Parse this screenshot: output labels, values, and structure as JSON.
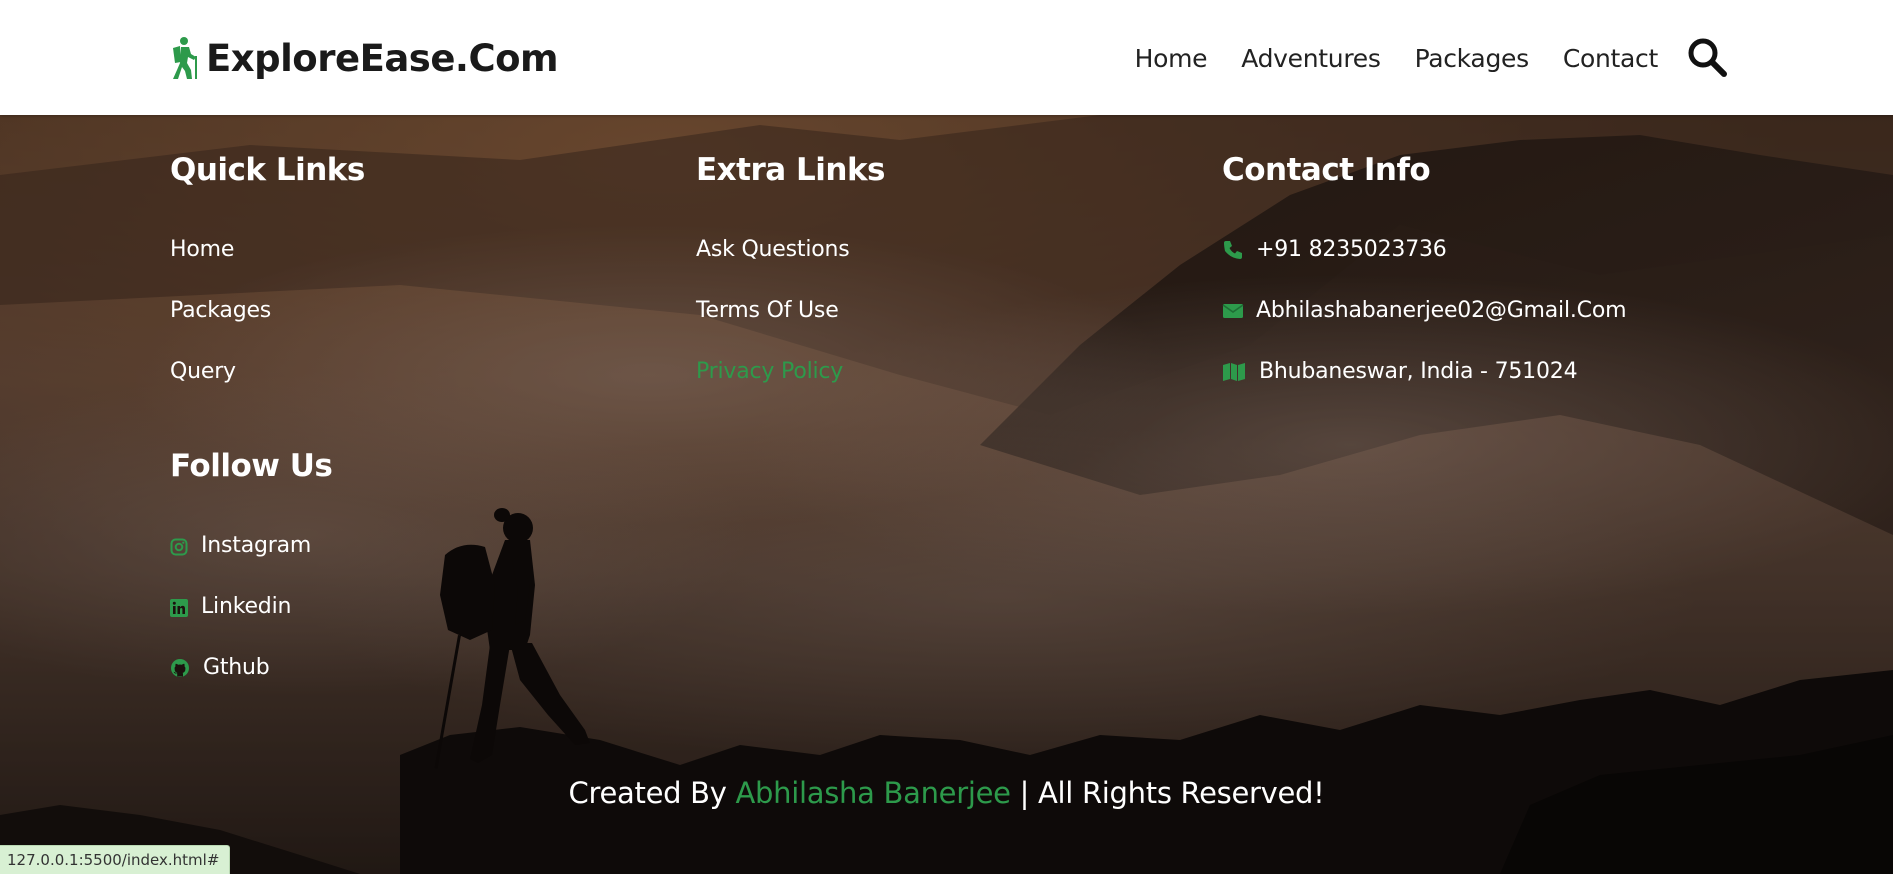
{
  "header": {
    "logo_text": "ExploreEase.Com",
    "logo_icon": "hiking-icon",
    "nav": [
      "Home",
      "Adventures",
      "Packages",
      "Contact"
    ],
    "search_icon": "search-icon"
  },
  "footer": {
    "quick_links": {
      "title": "Quick Links",
      "items": [
        "Home",
        "Packages",
        "Query"
      ]
    },
    "extra_links": {
      "title": "Extra Links",
      "items": [
        "Ask Questions",
        "Terms Of Use",
        "Privacy Policy"
      ],
      "active_index": 2
    },
    "contact_info": {
      "title": "Contact Info",
      "phone": "+91 8235023736",
      "email": "Abhilashabanerjee02@Gmail.Com",
      "address": "Bhubaneswar, India - 751024"
    },
    "follow_us": {
      "title": "Follow Us",
      "items": [
        {
          "label": "Instagram",
          "icon": "instagram-icon"
        },
        {
          "label": "Linkedin",
          "icon": "linkedin-icon"
        },
        {
          "label": "Gthub",
          "icon": "github-icon"
        }
      ]
    },
    "credit": {
      "prefix": "Created By",
      "author": "Abhilasha Banerjee",
      "suffix": "| All Rights Reserved!"
    }
  },
  "status_bar": {
    "url": "127.0.0.1:5500/index.html#"
  },
  "colors": {
    "accent": "#2d9a4b",
    "header_bg": "#ffffff",
    "text_on_dark": "#ffffff"
  }
}
